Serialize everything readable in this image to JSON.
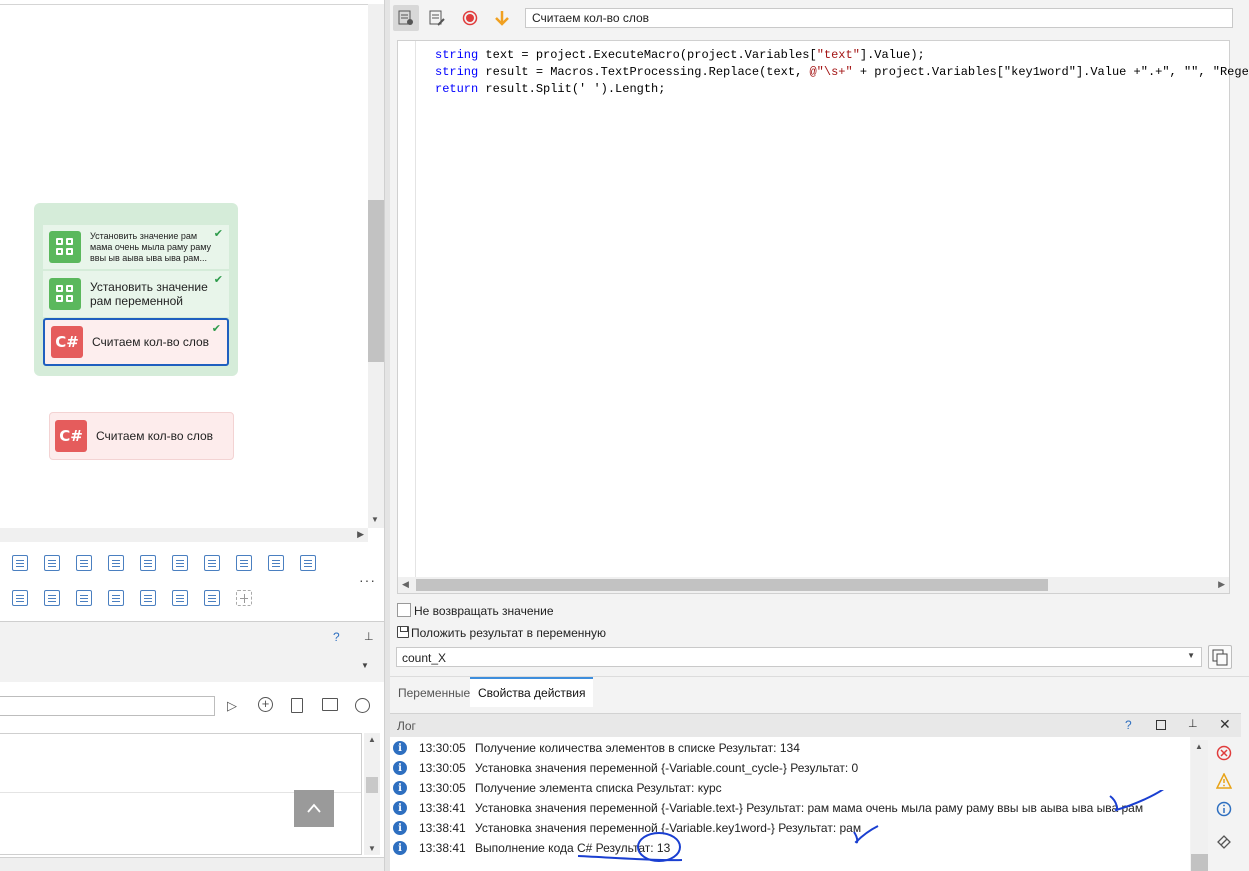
{
  "canvas": {
    "group_blocks": [
      {
        "label": "Установить значение  рам мама очень мыла раму раму ввы ыв аыва ыва ыва рам..."
      },
      {
        "label": "Установить значение рам переменной"
      },
      {
        "label": "Считаем кол-во слов"
      }
    ],
    "standalone_block": {
      "label": "Считаем кол-во слов",
      "icon_text": "C#"
    },
    "csharp_icon_text": "C#"
  },
  "left_panel": {
    "help_label": "?",
    "more_label": "···",
    "up_arrow": "^"
  },
  "action": {
    "title": "Считаем кол-во слов",
    "code_lines": [
      {
        "kw": "string",
        "rest": " text = project.ExecuteMacro(project.Variables[",
        "s1": "\"text\"",
        "tail": "].Value);"
      },
      {
        "kw": "string",
        "rest": " result = Macros.TextProcessing.Replace(text, ",
        "s1": "@\"\\s+\"",
        "tail": " + project.Variables[\"key1word\"].Value +\".+\", \"\", \"Regex"
      },
      {
        "kw": "return",
        "rest": " result.Split(' ').Length;",
        "s1": "",
        "tail": ""
      }
    ],
    "no_return_label": "Не возвращать значение",
    "save_result_label": "Положить результат в переменную",
    "variable_value": "count_X"
  },
  "tabs": [
    {
      "label": "Переменные",
      "active": false
    },
    {
      "label": "Свойства действия",
      "active": true
    }
  ],
  "log": {
    "title": "Лог",
    "help": "?",
    "entries": [
      {
        "time": "13:30:05",
        "message": "Получение количества элементов в списке  Результат: 134"
      },
      {
        "time": "13:30:05",
        "message": "Установка значения переменной {-Variable.count_cycle-} Результат: 0"
      },
      {
        "time": "13:30:05",
        "message": "Получение элемента списка  Результат: курс"
      },
      {
        "time": "13:38:41",
        "message": "Установка значения переменной {-Variable.text-} Результат: рам мама очень мыла раму раму ввы ыв аыва ыва ыва рам"
      },
      {
        "time": "13:38:41",
        "message": "Установка значения переменной {-Variable.key1word-} Результат: рам"
      },
      {
        "time": "13:38:41",
        "message": "Выполнение кода C# Результат: 13"
      }
    ]
  },
  "colors": {
    "group_bg": "#d5ecd9",
    "green_icon": "#5bb85d",
    "red_icon": "#e55c5c",
    "accent": "#3e8edc",
    "annotation_ink": "#1a3fd1"
  }
}
